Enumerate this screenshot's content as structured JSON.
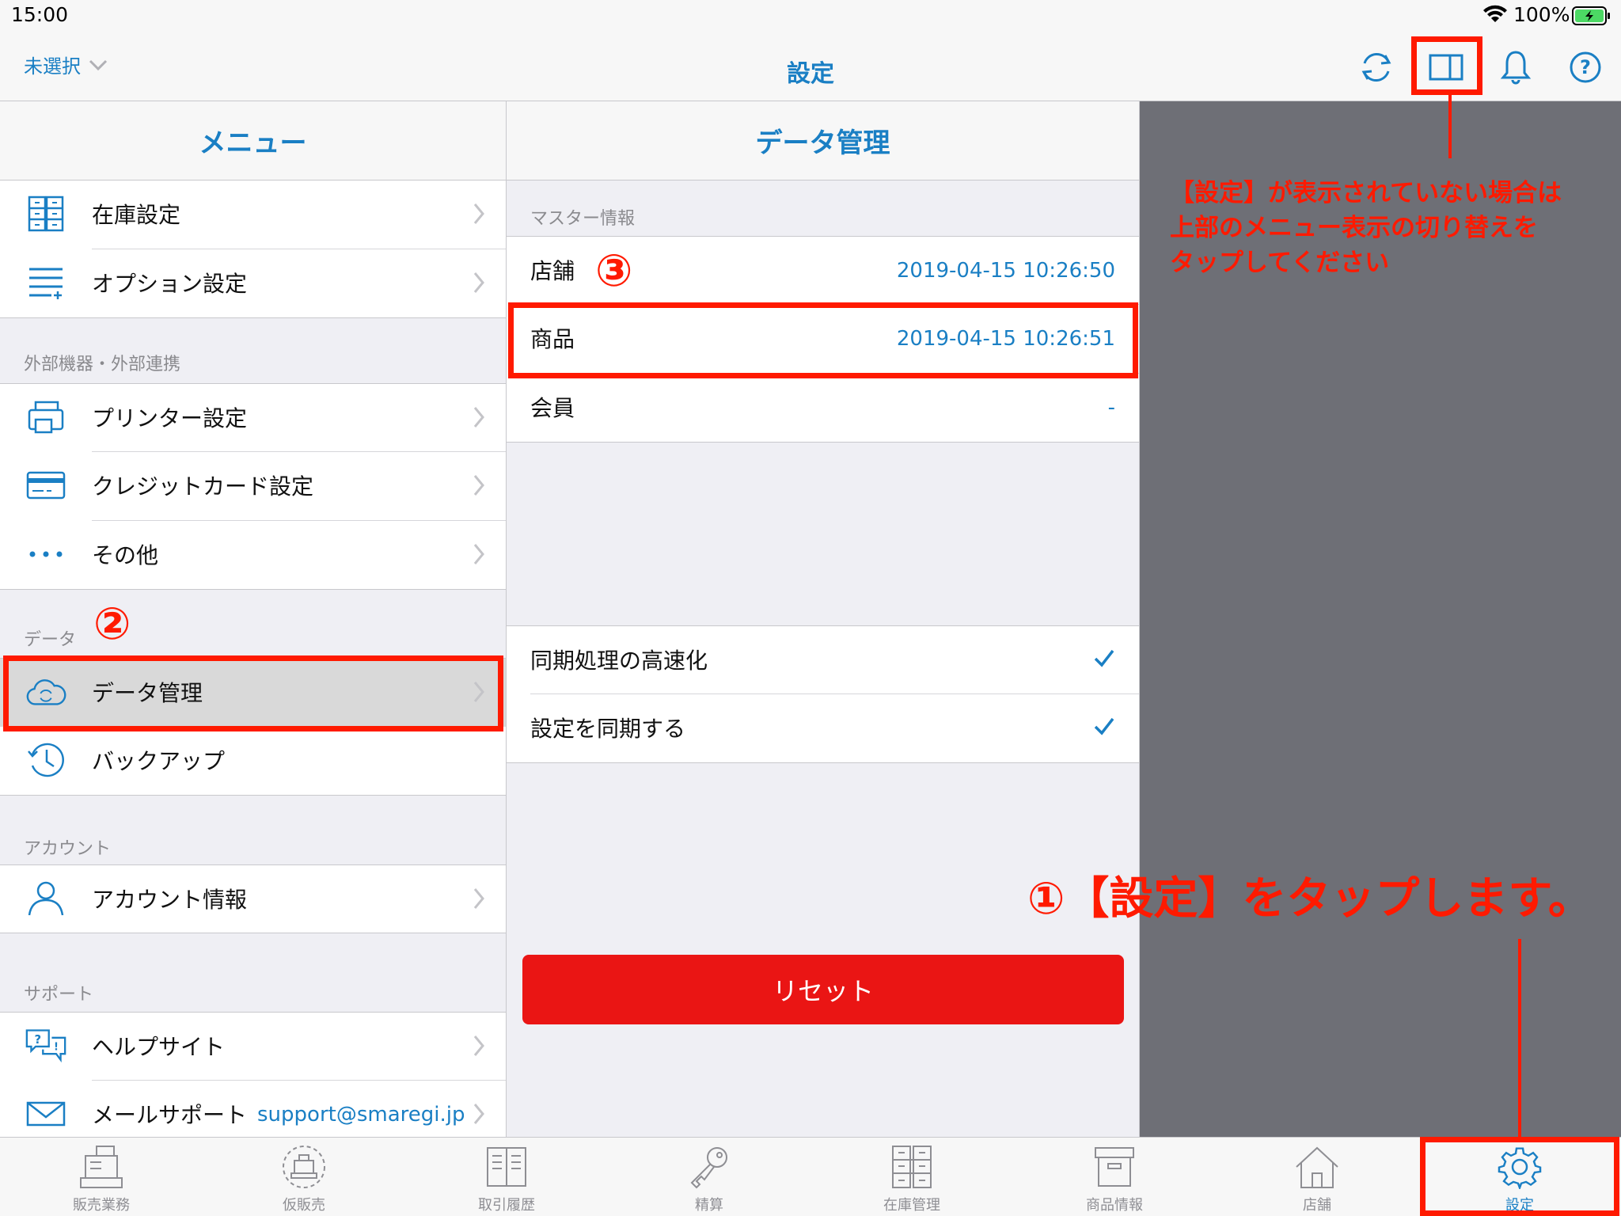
{
  "status_bar": {
    "time": "15:00",
    "battery": "100%"
  },
  "nav": {
    "store_select": "未選択",
    "title": "設定"
  },
  "menu": {
    "header": "メニュー",
    "items_top": [
      {
        "label": "在庫設定",
        "icon": "inventory-icon"
      },
      {
        "label": "オプション設定",
        "icon": "list-add-icon"
      }
    ],
    "section_external": "外部機器・外部連携",
    "items_external": [
      {
        "label": "プリンター設定",
        "icon": "printer-icon"
      },
      {
        "label": "クレジットカード設定",
        "icon": "credit-card-icon"
      },
      {
        "label": "その他",
        "icon": "more-icon"
      }
    ],
    "section_data": "データ",
    "items_data": [
      {
        "label": "データ管理",
        "icon": "cloud-sync-icon"
      },
      {
        "label": "バックアップ",
        "icon": "history-icon"
      }
    ],
    "section_account": "アカウント",
    "items_account": [
      {
        "label": "アカウント情報",
        "icon": "user-icon"
      }
    ],
    "section_support": "サポート",
    "items_support": [
      {
        "label": "ヘルプサイト",
        "icon": "help-chat-icon"
      },
      {
        "label": "メールサポート",
        "icon": "mail-icon",
        "extra": "support@smaregi.jp"
      }
    ]
  },
  "detail": {
    "header": "データ管理",
    "section_master": "マスター情報",
    "master_rows": [
      {
        "label": "店舗",
        "value": "2019-04-15 10:26:50"
      },
      {
        "label": "商品",
        "value": "2019-04-15 10:26:51"
      },
      {
        "label": "会員",
        "value": "-"
      }
    ],
    "options": [
      {
        "label": "同期処理の高速化",
        "checked": true
      },
      {
        "label": "設定を同期する",
        "checked": true
      }
    ],
    "reset_label": "リセット"
  },
  "tabs": [
    {
      "label": "販売業務",
      "icon": "register-icon"
    },
    {
      "label": "仮販売",
      "icon": "temp-sale-icon"
    },
    {
      "label": "取引履歴",
      "icon": "receipt-book-icon"
    },
    {
      "label": "精算",
      "icon": "key-icon"
    },
    {
      "label": "在庫管理",
      "icon": "inventory-icon"
    },
    {
      "label": "商品情報",
      "icon": "box-icon"
    },
    {
      "label": "店舗",
      "icon": "home-icon"
    },
    {
      "label": "設定",
      "icon": "gear-icon",
      "active": true
    }
  ],
  "annotations": {
    "note_top_right": [
      "【設定】が表示されていない場合は",
      "上部のメニュー表示の切り替えを",
      "タップしてください"
    ],
    "note_step1": "①【設定】をタップします。",
    "step2": "②",
    "step3": "③"
  },
  "colors": {
    "accent": "#1a7fc4",
    "reset": "#ea1514",
    "annotation": "#ff1a00",
    "grey_area": "#6e6f76"
  }
}
